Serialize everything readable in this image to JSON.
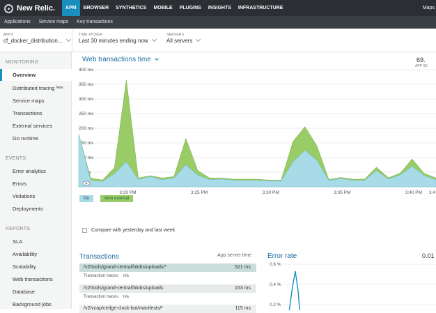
{
  "brand": {
    "name": "New Relic."
  },
  "topnav": {
    "items": [
      "APM",
      "BROWSER",
      "SYNTHETICS",
      "MOBILE",
      "PLUGINS",
      "INSIGHTS",
      "INFRASTRUCTURE"
    ],
    "active": "APM",
    "right_label": "Maps"
  },
  "subnav": {
    "items": [
      "Applications",
      "Service maps",
      "Key transactions"
    ]
  },
  "filters": {
    "apps": {
      "label": "APPS",
      "value": "cf_docker_distribution..."
    },
    "time_picker": {
      "label": "TIME PICKER",
      "value": "Last 30 minutes ending now"
    },
    "servers": {
      "label": "SERVERS",
      "value": "All servers"
    }
  },
  "sidebar": {
    "monitoring_title": "MONITORING",
    "monitoring": [
      {
        "label": "Overview",
        "active": true
      },
      {
        "label": "Distributed tracing",
        "badge": "New"
      },
      {
        "label": "Service maps"
      },
      {
        "label": "Transactions"
      },
      {
        "label": "External services"
      },
      {
        "label": "Go runtime"
      }
    ],
    "events_title": "EVENTS",
    "events": [
      {
        "label": "Error analytics"
      },
      {
        "label": "Errors"
      },
      {
        "label": "Violations"
      },
      {
        "label": "Deployments"
      }
    ],
    "reports_title": "REPORTS",
    "reports": [
      {
        "label": "SLA"
      },
      {
        "label": "Availability"
      },
      {
        "label": "Scalability"
      },
      {
        "label": "Web transactions"
      },
      {
        "label": "Database"
      },
      {
        "label": "Background jobs"
      }
    ]
  },
  "apdex": {
    "value": "69.",
    "label": "APP SE"
  },
  "compare_label": "Compare with yesterday and last week",
  "colors": {
    "go": "#a8dbe8",
    "web_external": "#99cc66",
    "accent": "#1a8fbf"
  },
  "chart_data": {
    "type": "area",
    "title": "Web transactions time",
    "ylabel": "",
    "y_ticks": [
      "400 ms",
      "350 ms",
      "300 ms",
      "250 ms",
      "200 ms",
      "150 ms",
      "100 ms",
      "50 ms"
    ],
    "x_ticks": [
      "3:20 PM",
      "3:25 PM",
      "3:30 PM",
      "3:35 PM",
      "3:40 PM",
      "3:4"
    ],
    "ylim": [
      0,
      400
    ],
    "stacked": true,
    "x": [
      0,
      1,
      2,
      3,
      4,
      5,
      6,
      7,
      8,
      9,
      10,
      11,
      12,
      13,
      14,
      15,
      16,
      17,
      18,
      19,
      20,
      21,
      22,
      23,
      24,
      25,
      26,
      27,
      28,
      29,
      30
    ],
    "series": [
      {
        "name": "Go",
        "values": [
          180,
          22,
          18,
          45,
          85,
          25,
          35,
          24,
          30,
          75,
          40,
          24,
          26,
          22,
          22,
          22,
          20,
          20,
          85,
          125,
          90,
          22,
          28,
          22,
          22,
          55,
          26,
          40,
          70,
          38,
          24
        ]
      },
      {
        "name": "Web external",
        "values": [
          0,
          8,
          5,
          20,
          280,
          5,
          3,
          6,
          5,
          90,
          15,
          6,
          4,
          4,
          4,
          4,
          3,
          3,
          70,
          80,
          50,
          3,
          4,
          4,
          4,
          12,
          5,
          7,
          25,
          8,
          6
        ]
      }
    ],
    "legend": [
      "Go",
      "Web external"
    ],
    "grid": true,
    "legend_position": "bottom-left"
  },
  "transactions": {
    "title": "Transactions",
    "column": "App server time",
    "rows": [
      {
        "name": "/v2/tools/grand-central/blobs/uploads/*",
        "value": "521 ms",
        "traces_label": "Transaction traces:",
        "traces": "n/a"
      },
      {
        "name": "/v2/tools/grand-central/blobs/uploads",
        "value": "153 ms",
        "traces_label": "Transaction traces:",
        "traces": "n/a"
      },
      {
        "name": "/v2/vcap/cedge-clock-bot/manifests/*",
        "value": "115 ms"
      }
    ]
  },
  "error_rate": {
    "title": "Error rate",
    "value": "0.01",
    "y_ticks": [
      "0.6 %",
      "0.4 %",
      "0.2 %"
    ]
  }
}
